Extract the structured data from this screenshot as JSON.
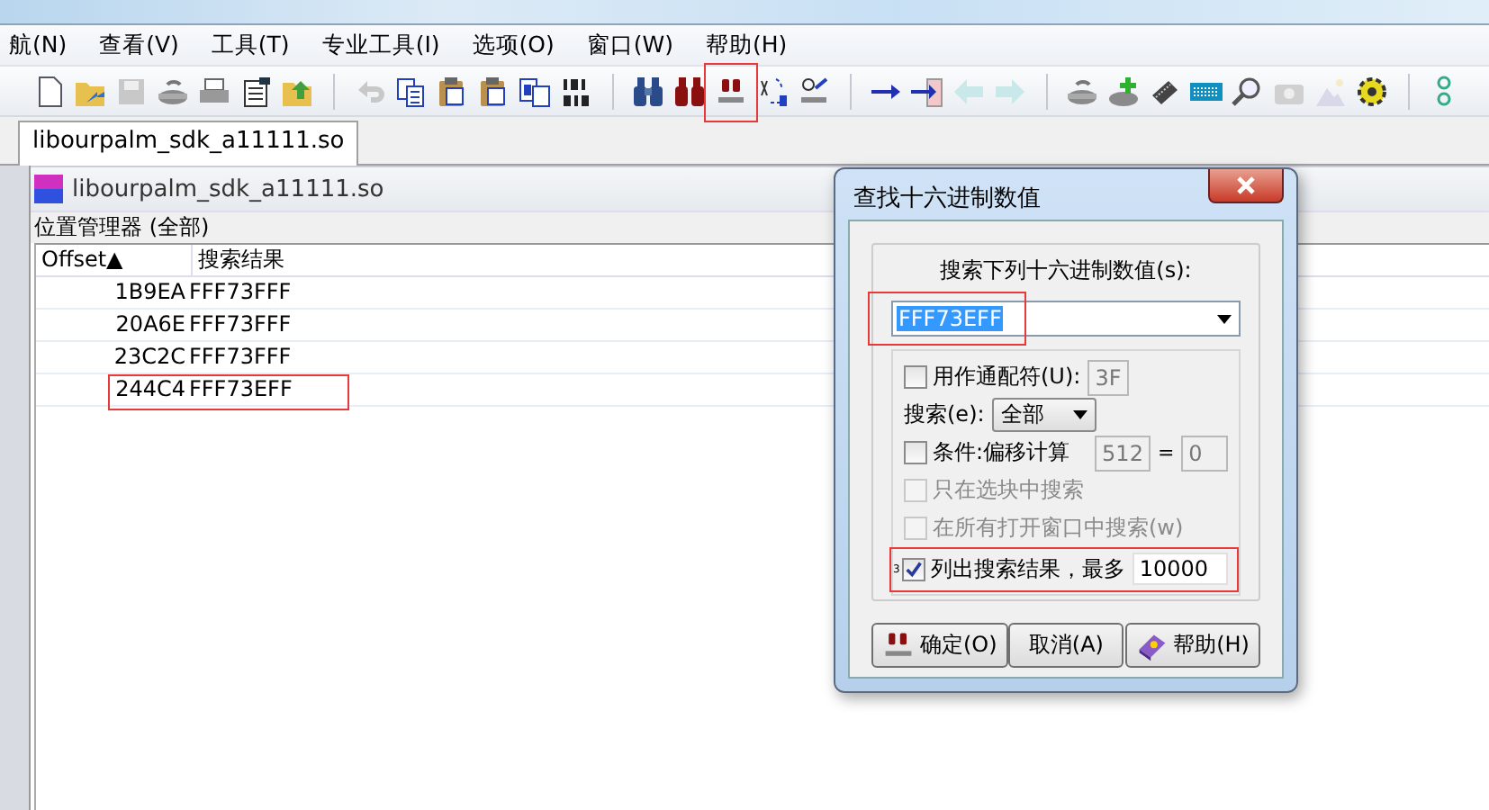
{
  "menu": [
    {
      "label": "航(N)"
    },
    {
      "label": "查看(V)"
    },
    {
      "label": "工具(T)"
    },
    {
      "label": "专业工具(I)"
    },
    {
      "label": "选项(O)"
    },
    {
      "label": "窗口(W)"
    },
    {
      "label": "帮助(H)"
    }
  ],
  "toolbar": [
    [
      {
        "disabled": false
      },
      {
        "disabled": false
      },
      {
        "disabled": true
      },
      {
        "disabled": false
      },
      {
        "disabled": false
      },
      {
        "disabled": false
      },
      {
        "disabled": false
      }
    ],
    [
      {
        "disabled": true
      },
      {
        "disabled": false
      },
      {
        "disabled": false
      },
      {
        "disabled": false
      },
      {
        "disabled": false
      },
      {
        "disabled": false
      }
    ],
    [
      {
        "disabled": false
      },
      {
        "disabled": false
      },
      {
        "disabled": false,
        "highlighted": true
      },
      {
        "disabled": false
      },
      {
        "disabled": false
      }
    ],
    [
      {
        "disabled": false
      },
      {
        "disabled": false
      },
      {
        "disabled": true
      },
      {
        "disabled": true
      }
    ],
    [
      {
        "disabled": false
      },
      {
        "disabled": false
      },
      {
        "disabled": false
      },
      {
        "disabled": false
      },
      {
        "disabled": false
      },
      {
        "disabled": true
      },
      {
        "disabled": true
      },
      {
        "disabled": false
      }
    ],
    [
      {
        "disabled": false
      }
    ]
  ],
  "tabs": [
    {
      "label": "libourpalm_sdk_a11111.so",
      "selected": true
    }
  ],
  "document": {
    "title": "libourpalm_sdk_a11111.so",
    "panel_title": "位置管理器 (全部)",
    "columns": [
      {
        "label": "Offset",
        "sort_mark": "▲"
      },
      {
        "label": "搜索结果"
      }
    ],
    "rows": [
      {
        "offset": "1B9EA",
        "result": "FFF73FFF",
        "highlighted": false
      },
      {
        "offset": "20A6E",
        "result": "FFF73FFF",
        "highlighted": false
      },
      {
        "offset": "23C2C",
        "result": "FFF73FFF",
        "highlighted": false
      },
      {
        "offset": "244C4",
        "result": "FFF73EFF",
        "highlighted": true
      }
    ]
  },
  "dialog": {
    "title": "查找十六进制数值",
    "search_label": "搜索下列十六进制数值(s):",
    "search_value": "FFF73EFF",
    "search_highlighted": true,
    "wildcard": {
      "label": "用作通配符(U):",
      "checked": false,
      "value": "3F"
    },
    "scope_label": "搜索(e):",
    "scope_value": "全部",
    "condition": {
      "label": "条件:偏移计算",
      "checked": false,
      "value1": "512",
      "equals": "=",
      "value2": "0"
    },
    "options": [
      {
        "label": "只在选块中搜索",
        "checked": false,
        "disabled": true
      },
      {
        "label": "在所有打开窗口中搜索(w)",
        "checked": false,
        "disabled": true
      }
    ],
    "list_results": {
      "marker": "3",
      "label": "列出搜索结果，最多",
      "checked": true,
      "value": "10000",
      "highlighted": true
    },
    "buttons": [
      {
        "label": "确定(O)",
        "kind": "ok"
      },
      {
        "label": "取消(A)",
        "kind": "plain"
      },
      {
        "label": "帮助(H)",
        "kind": "help"
      }
    ]
  }
}
